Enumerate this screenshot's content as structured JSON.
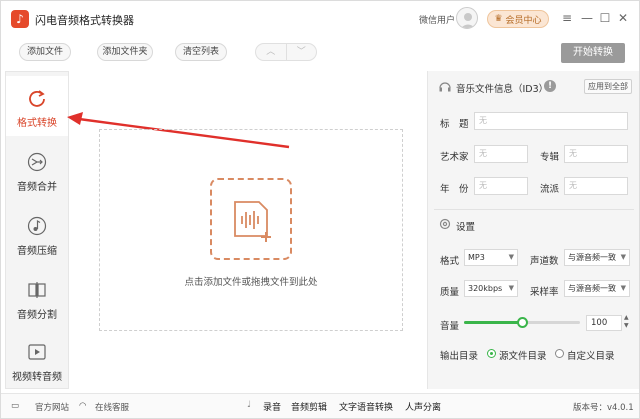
{
  "app": {
    "title": "闪电音频格式转换器",
    "user_name": "微信用户",
    "vip_label": "会员中心"
  },
  "toolbar": {
    "add_file": "添加文件",
    "add_folder": "添加文件夹",
    "clear_list": "清空列表",
    "start": "开始转换"
  },
  "sidebar": {
    "items": [
      {
        "label": "格式转换",
        "icon": "refresh-icon",
        "active": true
      },
      {
        "label": "音频合并",
        "icon": "merge-icon"
      },
      {
        "label": "音频压缩",
        "icon": "music-note-icon"
      },
      {
        "label": "音频分割",
        "icon": "split-icon"
      },
      {
        "label": "视频转音频",
        "icon": "play-icon"
      }
    ]
  },
  "dropzone": {
    "text": "点击添加文件或拖拽文件到此处"
  },
  "id3": {
    "title": "音乐文件信息（ID3）",
    "apply_all": "应用到全部",
    "fields": {
      "title_label": "标　题",
      "artist_label": "艺术家",
      "album_label": "专辑",
      "year_label": "年　份",
      "genre_label": "流派",
      "placeholder": "无"
    }
  },
  "settings": {
    "title": "设置",
    "format_label": "格式",
    "format_value": "MP3",
    "channels_label": "声道数",
    "channels_value": "与源音频一致",
    "quality_label": "质量",
    "quality_value": "320kbps",
    "samplerate_label": "采样率",
    "samplerate_value": "与源音频一致",
    "volume_label": "音量",
    "volume_value": "100",
    "volume_level": 0.5,
    "output_label": "输出目录",
    "output_source": "源文件目录",
    "output_custom": "自定义目录"
  },
  "footer": {
    "website": "官方网站",
    "support": "在线客服",
    "tools": [
      "录音",
      "音频剪辑",
      "文字语音转换",
      "人声分离"
    ],
    "version": "版本号：v4.0.1"
  },
  "colors": {
    "accent": "#d9452a",
    "green": "#3ab54a",
    "start_button": "#9a9a9a"
  }
}
